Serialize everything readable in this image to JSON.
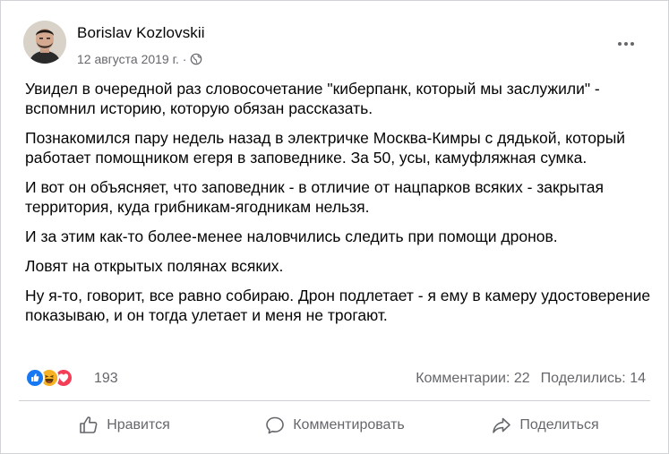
{
  "post": {
    "author": "Borislav Kozlovskii",
    "date": "12 августа 2019 г. ·",
    "paragraphs": [
      "Увидел в очередной раз словосочетание \"киберпанк, который мы заслужили\" - вспомнил историю, которую обязан рассказать.",
      "Познакомился пару недель назад в электричке Москва-Кимры с дядькой, который работает помощником егеря в заповеднике. За 50, усы, камуфляжная сумка.",
      "И вот он объясняет, что заповедник - в отличие от нацпарков всяких - закрытая территория, куда грибникам-ягодникам нельзя.",
      "И за этим как-то более-менее наловчились следить при помощи дронов.",
      "Ловят на открытых полянах всяких.",
      "Ну я-то, говорит, все равно собираю. Дрон подлетает - я ему в камеру удостоверение показываю, и он тогда улетает и меня не трогают."
    ]
  },
  "reactions": {
    "icons": [
      "like-reaction",
      "haha-reaction",
      "love-reaction"
    ],
    "count": "193",
    "colors": {
      "like": "#1877f2",
      "haha": "#f7b125",
      "love": "#f33e58"
    }
  },
  "stats": {
    "comments": "Комментарии: 22",
    "shares": "Поделились: 14"
  },
  "actions": {
    "like": "Нравится",
    "comment": "Комментировать",
    "share": "Поделиться"
  }
}
